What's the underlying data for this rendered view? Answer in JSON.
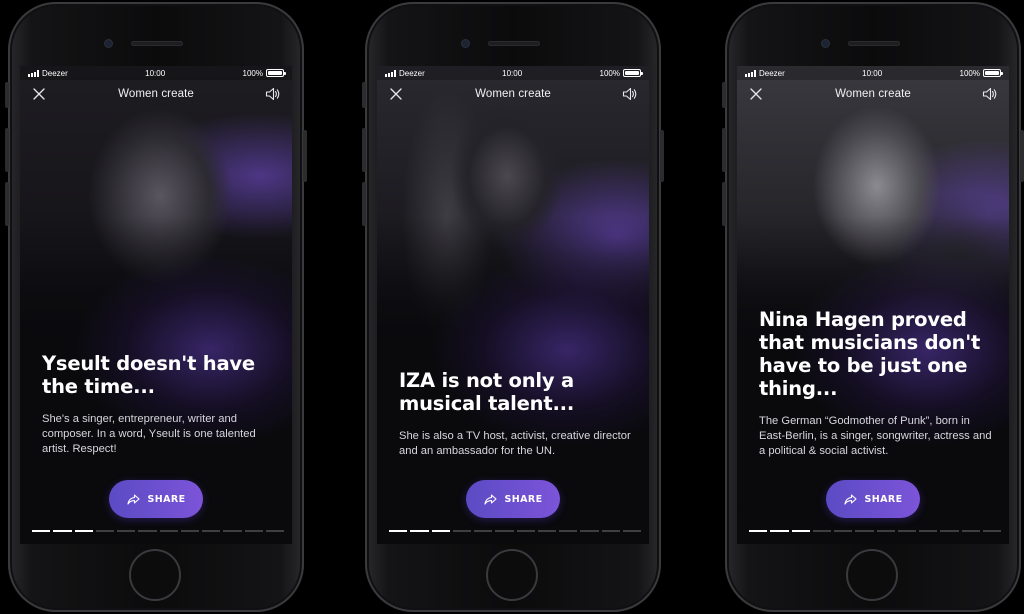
{
  "phones": [
    {
      "status": {
        "carrier": "Deezer",
        "time": "10:00",
        "battery": "100%"
      },
      "header": {
        "title": "Women create"
      },
      "headline": "Yseult doesn't have the time...",
      "body": "She's a singer, entrepreneur, writer and composer. In a word, Yseult is one talented artist. Respect!",
      "share_label": "SHARE",
      "progress": {
        "total": 12,
        "active": 3
      }
    },
    {
      "status": {
        "carrier": "Deezer",
        "time": "10:00",
        "battery": "100%"
      },
      "header": {
        "title": "Women create"
      },
      "headline": "IZA is not only a musical talent...",
      "body": "She is also a TV host, activist, creative director and an ambassador for the UN.",
      "share_label": "SHARE",
      "progress": {
        "total": 12,
        "active": 3
      }
    },
    {
      "status": {
        "carrier": "Deezer",
        "time": "10:00",
        "battery": "100%"
      },
      "header": {
        "title": "Women create"
      },
      "headline": "Nina Hagen proved that musicians don't have to be just one thing...",
      "body": "The German “Godmother of Punk”, born in East-Berlin, is a singer, songwriter, actress and a political & social activist.",
      "share_label": "SHARE",
      "progress": {
        "total": 12,
        "active": 3
      }
    }
  ],
  "icons": {
    "close": "close-icon",
    "sound": "speaker-icon",
    "share": "share-icon"
  },
  "colors": {
    "accent_start": "#5b4bc4",
    "accent_end": "#7c54d8",
    "screen_bg": "#0a0a0d"
  }
}
